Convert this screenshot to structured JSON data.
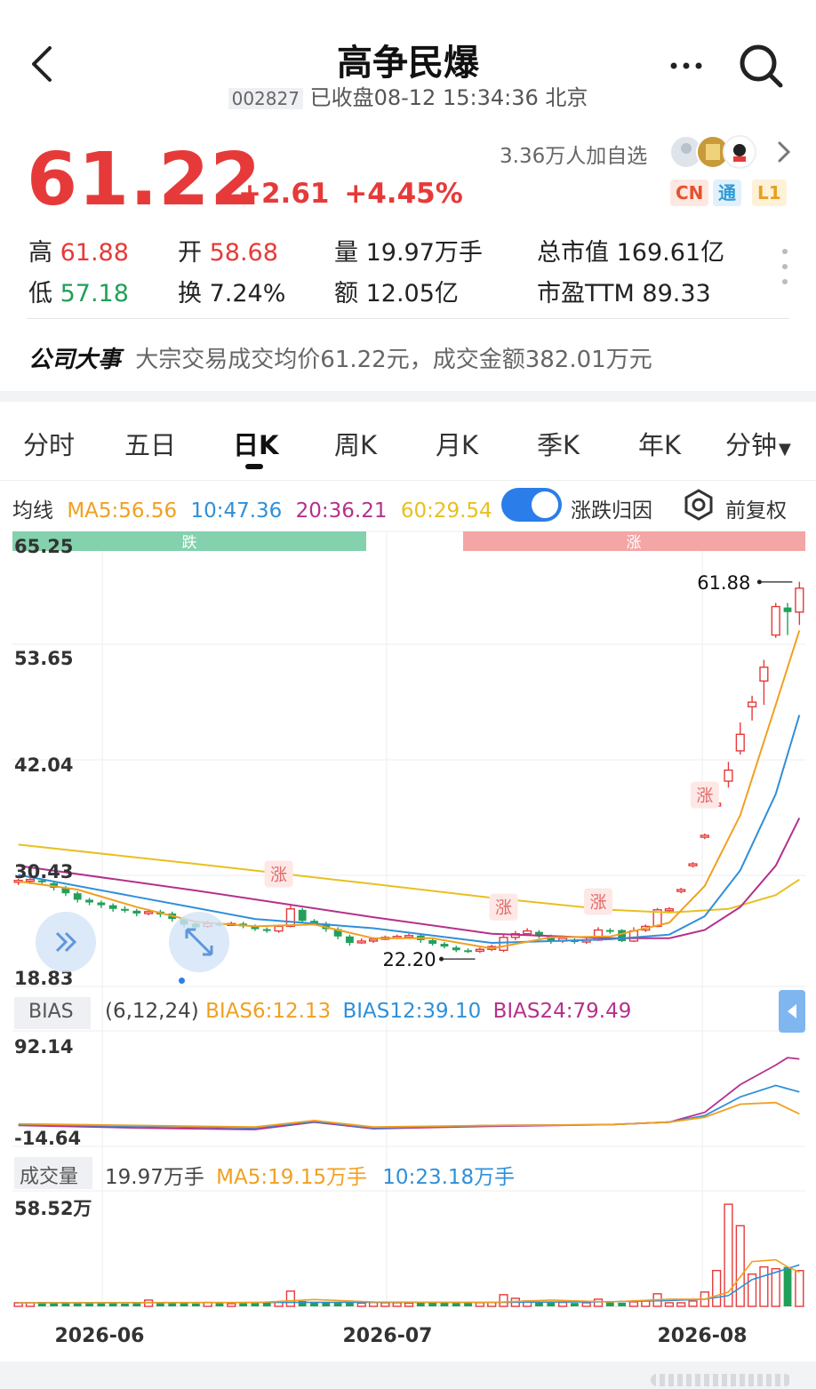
{
  "header": {
    "title": "高争民爆",
    "code": "002827",
    "status": "已收盘08-12 15:34:36 北京",
    "followers": "3.36万人加自选"
  },
  "quote": {
    "price": "61.22",
    "change": "+2.61",
    "change_pct": "+4.45%",
    "badges": [
      "CN",
      "通",
      "L1"
    ]
  },
  "stats": [
    {
      "label": "高",
      "value": "61.88",
      "tone": "red"
    },
    {
      "label": "开",
      "value": "58.68",
      "tone": "red"
    },
    {
      "label": "量",
      "value": "19.97万手",
      "tone": "plain"
    },
    {
      "label": "总市值",
      "value": "169.61亿",
      "tone": "plain"
    },
    {
      "label": "低",
      "value": "57.18",
      "tone": "green"
    },
    {
      "label": "换",
      "value": "7.24%",
      "tone": "plain"
    },
    {
      "label": "额",
      "value": "12.05亿",
      "tone": "plain"
    },
    {
      "label": "市盈TTM",
      "value": "89.33",
      "tone": "plain"
    }
  ],
  "news": {
    "label": "公司大事",
    "text": "大宗交易成交均价61.22元，成交金额382.01万元"
  },
  "tabs": [
    "分时",
    "五日",
    "日K",
    "周K",
    "月K",
    "季K",
    "年K",
    "分钟"
  ],
  "active_tab": "日K",
  "ma_bar": {
    "label": "均线",
    "ma5": "MA5:56.56",
    "ma10": "10:47.36",
    "ma20": "20:36.21",
    "ma60": "60:29.54",
    "toggle_label": "涨跌归因",
    "adjust_label": "前复权"
  },
  "colors": {
    "up": "#e63a3a",
    "down": "#21a05a",
    "ma5": "#f0a020",
    "ma10": "#2f8fd8",
    "ma20": "#b5308c",
    "ma60": "#e8c020",
    "toggle": "#2b7de9"
  },
  "bias": {
    "label": "BIAS",
    "params": "(6,12,24)",
    "b6": "BIAS6:12.13",
    "b12": "BIAS12:39.10",
    "b24": "BIAS24:79.49",
    "ymax_label": "92.14",
    "ymin_label": "-14.64"
  },
  "volume": {
    "label": "成交量",
    "current": "19.97万手",
    "ma5": "MA5:19.15万手",
    "ma10": "10:23.18万手",
    "ymax_label": "58.52万"
  },
  "chart_data": {
    "type": "candlestick",
    "y_axis_labels": [
      "65.25",
      "53.65",
      "42.04",
      "30.43",
      "18.83"
    ],
    "ylim": [
      18.83,
      65.25
    ],
    "x_labels": [
      "2026-06",
      "2026-07",
      "2026-08"
    ],
    "region_labels": [
      "跌",
      "涨"
    ],
    "marker_label": "涨",
    "annotations": {
      "high": "61.88",
      "low": "22.20"
    },
    "candles": [
      [
        29.2,
        29.4,
        29.6,
        28.9
      ],
      [
        29.3,
        29.5,
        29.7,
        29.0
      ],
      [
        29.4,
        29.2,
        29.6,
        28.9
      ],
      [
        29.1,
        28.6,
        29.3,
        28.3
      ],
      [
        28.6,
        28.0,
        28.8,
        27.7
      ],
      [
        28.0,
        27.3,
        28.2,
        27.0
      ],
      [
        27.3,
        27.0,
        27.5,
        26.7
      ],
      [
        27.0,
        26.7,
        27.2,
        26.4
      ],
      [
        26.7,
        26.3,
        26.9,
        26.0
      ],
      [
        26.3,
        26.1,
        26.6,
        25.9
      ],
      [
        26.1,
        25.8,
        26.3,
        25.5
      ],
      [
        25.8,
        26.0,
        26.3,
        25.6
      ],
      [
        26.0,
        25.7,
        26.2,
        25.4
      ],
      [
        25.8,
        25.2,
        26.0,
        24.9
      ],
      [
        25.2,
        24.6,
        25.4,
        24.3
      ],
      [
        24.7,
        24.3,
        24.9,
        24.0
      ],
      [
        24.4,
        24.7,
        25.0,
        24.2
      ],
      [
        24.7,
        24.6,
        24.9,
        24.4
      ],
      [
        24.6,
        24.7,
        24.9,
        24.5
      ],
      [
        24.7,
        24.4,
        24.9,
        24.2
      ],
      [
        24.4,
        24.1,
        24.6,
        23.9
      ],
      [
        24.1,
        23.9,
        24.3,
        23.7
      ],
      [
        23.9,
        24.4,
        24.6,
        23.7
      ],
      [
        24.4,
        26.3,
        26.8,
        24.3
      ],
      [
        26.2,
        25.0,
        26.4,
        24.8
      ],
      [
        25.0,
        24.7,
        25.2,
        24.5
      ],
      [
        24.7,
        24.1,
        24.9,
        23.8
      ],
      [
        24.1,
        23.3,
        24.3,
        23.0
      ],
      [
        23.3,
        22.6,
        23.5,
        22.3
      ],
      [
        22.7,
        22.8,
        23.1,
        22.5
      ],
      [
        22.8,
        23.0,
        23.2,
        22.6
      ],
      [
        23.0,
        23.2,
        23.4,
        22.9
      ],
      [
        23.2,
        23.3,
        23.5,
        23.0
      ],
      [
        23.3,
        23.4,
        23.6,
        23.1
      ],
      [
        23.4,
        22.9,
        23.6,
        22.6
      ],
      [
        22.9,
        22.5,
        23.1,
        22.3
      ],
      [
        22.5,
        22.2,
        22.7,
        22.0
      ],
      [
        22.1,
        21.8,
        22.3,
        21.6
      ],
      [
        21.8,
        21.7,
        22.0,
        21.5
      ],
      [
        21.7,
        21.9,
        22.1,
        21.5
      ],
      [
        21.9,
        22.2,
        22.4,
        21.7
      ],
      [
        21.8,
        23.2,
        23.5,
        21.6
      ],
      [
        23.2,
        23.6,
        23.9,
        22.9
      ],
      [
        23.6,
        23.9,
        24.2,
        23.4
      ],
      [
        23.8,
        23.3,
        24.0,
        23.1
      ],
      [
        23.3,
        22.8,
        23.5,
        22.5
      ],
      [
        22.8,
        23.1,
        23.4,
        22.6
      ],
      [
        22.9,
        22.7,
        23.1,
        22.5
      ],
      [
        22.7,
        22.9,
        23.2,
        22.5
      ],
      [
        22.9,
        24.0,
        24.3,
        22.8
      ],
      [
        24.0,
        23.9,
        24.2,
        23.6
      ],
      [
        24.0,
        22.8,
        24.1,
        22.7
      ],
      [
        22.8,
        23.9,
        24.3,
        22.7
      ],
      [
        24.0,
        24.4,
        24.6,
        23.8
      ],
      [
        24.4,
        26.2,
        26.4,
        24.3
      ],
      [
        26.1,
        26.3,
        26.5,
        25.9
      ],
      [
        28.2,
        28.4,
        28.6,
        28.0
      ],
      [
        31.0,
        31.2,
        31.4,
        30.8
      ],
      [
        34.1,
        34.3,
        34.5,
        33.9
      ],
      [
        37.5,
        37.8,
        38.0,
        37.3
      ],
      [
        40.2,
        41.4,
        42.3,
        39.5
      ],
      [
        43.5,
        45.3,
        46.6,
        43.1
      ],
      [
        48.3,
        48.8,
        49.5,
        46.8
      ],
      [
        51.1,
        52.6,
        53.4,
        48.5
      ],
      [
        56.1,
        59.2,
        59.6,
        55.8
      ],
      [
        59.1,
        58.6,
        59.6,
        56.1
      ],
      [
        58.6,
        61.2,
        61.9,
        57.2
      ]
    ],
    "ma5": [
      [
        0,
        29.3
      ],
      [
        5,
        28.4
      ],
      [
        10,
        26.5
      ],
      [
        15,
        24.9
      ],
      [
        20,
        24.4
      ],
      [
        25,
        24.6
      ],
      [
        30,
        23.1
      ],
      [
        35,
        23.1
      ],
      [
        40,
        22.0
      ],
      [
        45,
        23.2
      ],
      [
        50,
        23.3
      ],
      [
        55,
        24.8
      ],
      [
        58,
        28.8
      ],
      [
        61,
        36.5
      ],
      [
        64,
        48.5
      ],
      [
        66,
        56.6
      ]
    ],
    "ma10": [
      [
        0,
        30.0
      ],
      [
        10,
        27.6
      ],
      [
        20,
        25.2
      ],
      [
        30,
        24.2
      ],
      [
        40,
        22.6
      ],
      [
        50,
        23.0
      ],
      [
        55,
        23.5
      ],
      [
        58,
        25.5
      ],
      [
        61,
        30.5
      ],
      [
        64,
        38.8
      ],
      [
        66,
        47.4
      ]
    ],
    "ma20": [
      [
        0,
        31.0
      ],
      [
        15,
        28.3
      ],
      [
        30,
        25.4
      ],
      [
        40,
        23.6
      ],
      [
        50,
        23.1
      ],
      [
        55,
        23.1
      ],
      [
        58,
        24.0
      ],
      [
        61,
        26.5
      ],
      [
        64,
        31.0
      ],
      [
        66,
        36.2
      ]
    ],
    "ma60": [
      [
        0,
        33.3
      ],
      [
        15,
        31.2
      ],
      [
        30,
        29.0
      ],
      [
        40,
        27.5
      ],
      [
        50,
        26.2
      ],
      [
        55,
        25.9
      ],
      [
        60,
        26.3
      ],
      [
        64,
        27.8
      ],
      [
        66,
        29.5
      ]
    ],
    "bias": {
      "ylim": [
        -14.64,
        92.14
      ],
      "bias6": [
        [
          0,
          0
        ],
        [
          10,
          -2
        ],
        [
          20,
          -4
        ],
        [
          25,
          4
        ],
        [
          30,
          -4
        ],
        [
          40,
          -2
        ],
        [
          50,
          -1
        ],
        [
          55,
          2
        ],
        [
          58,
          8
        ],
        [
          61,
          24
        ],
        [
          64,
          26
        ],
        [
          66,
          12.1
        ]
      ],
      "bias12": [
        [
          0,
          -1
        ],
        [
          10,
          -3
        ],
        [
          20,
          -5
        ],
        [
          25,
          3
        ],
        [
          30,
          -5
        ],
        [
          40,
          -2
        ],
        [
          50,
          -1
        ],
        [
          55,
          2
        ],
        [
          58,
          10
        ],
        [
          61,
          33
        ],
        [
          64,
          47
        ],
        [
          66,
          39.1
        ]
      ],
      "bias24": [
        [
          0,
          -2
        ],
        [
          10,
          -5
        ],
        [
          20,
          -7
        ],
        [
          25,
          2
        ],
        [
          30,
          -6
        ],
        [
          40,
          -3
        ],
        [
          50,
          -1
        ],
        [
          55,
          2
        ],
        [
          58,
          14
        ],
        [
          61,
          48
        ],
        [
          64,
          72
        ],
        [
          65,
          81
        ],
        [
          66,
          79.5
        ]
      ]
    },
    "volume": {
      "ylim": [
        0,
        58.52
      ],
      "values": [
        2,
        2,
        2.5,
        2,
        1.8,
        2,
        2.2,
        1.8,
        2,
        1.5,
        2.4,
        3.5,
        2,
        2,
        1.8,
        1.6,
        2.2,
        2,
        1.5,
        2,
        2,
        2,
        2.5,
        8.5,
        3,
        2.5,
        2.2,
        2.4,
        2,
        1.8,
        2.2,
        2,
        2,
        1.8,
        2,
        2.3,
        2,
        1.8,
        2,
        2,
        2.2,
        6.5,
        4.5,
        3,
        2.5,
        2,
        2.2,
        1.9,
        2,
        4,
        2.2,
        2,
        2.5,
        3,
        7,
        2,
        2,
        3,
        8,
        20,
        57,
        45,
        18,
        22,
        21,
        22,
        19.97
      ],
      "ma5": [
        [
          0,
          2
        ],
        [
          20,
          2.1
        ],
        [
          25,
          3.8
        ],
        [
          30,
          2.5
        ],
        [
          40,
          2.2
        ],
        [
          45,
          3.5
        ],
        [
          50,
          2.5
        ],
        [
          55,
          4
        ],
        [
          58,
          4
        ],
        [
          60,
          8
        ],
        [
          62,
          25
        ],
        [
          64,
          26
        ],
        [
          65,
          22
        ],
        [
          66,
          19.15
        ]
      ],
      "ma10": [
        [
          0,
          2
        ],
        [
          30,
          2.3
        ],
        [
          40,
          2.2
        ],
        [
          50,
          2.6
        ],
        [
          55,
          3.2
        ],
        [
          58,
          4
        ],
        [
          60,
          6
        ],
        [
          62,
          15
        ],
        [
          64,
          19
        ],
        [
          66,
          23.18
        ]
      ]
    }
  }
}
